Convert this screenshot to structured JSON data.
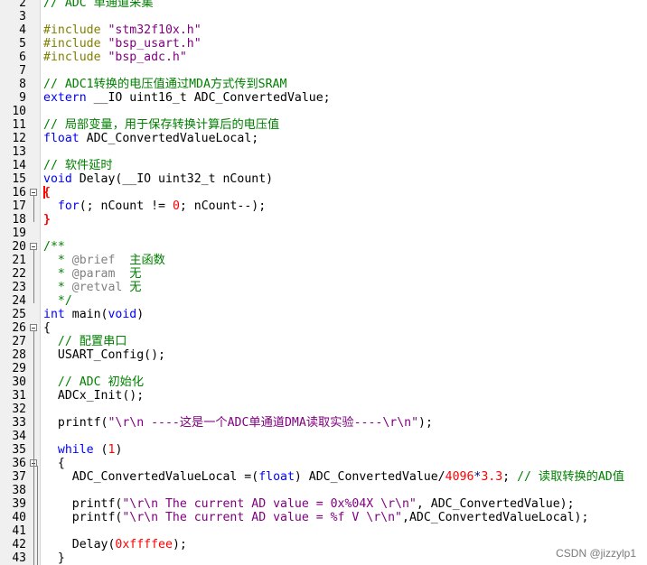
{
  "editor": {
    "lines": [
      {
        "n": "2",
        "fold": false,
        "segments": [
          {
            "c": "cm",
            "t": "// ADC 单通道采集"
          }
        ]
      },
      {
        "n": "3",
        "fold": false,
        "segments": []
      },
      {
        "n": "4",
        "fold": false,
        "segments": [
          {
            "c": "pp",
            "t": "#include "
          },
          {
            "c": "str",
            "t": "\"stm32f10x.h\""
          }
        ]
      },
      {
        "n": "5",
        "fold": false,
        "segments": [
          {
            "c": "pp",
            "t": "#include "
          },
          {
            "c": "str",
            "t": "\"bsp_usart.h\""
          }
        ]
      },
      {
        "n": "6",
        "fold": false,
        "segments": [
          {
            "c": "pp",
            "t": "#include "
          },
          {
            "c": "str",
            "t": "\"bsp_adc.h\""
          }
        ]
      },
      {
        "n": "7",
        "fold": false,
        "segments": []
      },
      {
        "n": "8",
        "fold": false,
        "segments": [
          {
            "c": "cm",
            "t": "// ADC1转换的电压值通过MDA方式传到SRAM"
          }
        ]
      },
      {
        "n": "9",
        "fold": false,
        "segments": [
          {
            "c": "kw",
            "t": "extern"
          },
          {
            "c": "ty",
            "t": " __IO uint16_t ADC_ConvertedValue;"
          }
        ]
      },
      {
        "n": "10",
        "fold": false,
        "segments": []
      },
      {
        "n": "11",
        "fold": false,
        "segments": [
          {
            "c": "cm",
            "t": "// 局部变量，用于保存转换计算后的电压值"
          }
        ]
      },
      {
        "n": "12",
        "fold": false,
        "segments": [
          {
            "c": "kw",
            "t": "float"
          },
          {
            "c": "ty",
            "t": " ADC_ConvertedValueLocal;"
          }
        ]
      },
      {
        "n": "13",
        "fold": false,
        "segments": []
      },
      {
        "n": "14",
        "fold": false,
        "segments": [
          {
            "c": "cm",
            "t": "// 软件延时"
          }
        ]
      },
      {
        "n": "15",
        "fold": false,
        "segments": [
          {
            "c": "kw",
            "t": "void"
          },
          {
            "c": "ty",
            "t": " Delay(__IO uint32_t nCount)"
          }
        ]
      },
      {
        "n": "16",
        "fold": true,
        "segments": [
          {
            "c": "brk",
            "t": "{"
          }
        ]
      },
      {
        "n": "17",
        "fold": false,
        "segments": [
          {
            "c": "ty",
            "t": "  "
          },
          {
            "c": "kw",
            "t": "for"
          },
          {
            "c": "ty",
            "t": "(; nCount != "
          },
          {
            "c": "num",
            "t": "0"
          },
          {
            "c": "ty",
            "t": "; nCount--);"
          }
        ]
      },
      {
        "n": "18",
        "fold": false,
        "segments": [
          {
            "c": "brk",
            "t": "}"
          }
        ]
      },
      {
        "n": "19",
        "fold": false,
        "segments": []
      },
      {
        "n": "20",
        "fold": true,
        "segments": [
          {
            "c": "cm",
            "t": "/**"
          }
        ]
      },
      {
        "n": "21",
        "fold": false,
        "segments": [
          {
            "c": "cm",
            "t": "  * "
          },
          {
            "c": "dt",
            "t": "@brief"
          },
          {
            "c": "cm",
            "t": "  主函数"
          }
        ]
      },
      {
        "n": "22",
        "fold": false,
        "segments": [
          {
            "c": "cm",
            "t": "  * "
          },
          {
            "c": "dt",
            "t": "@param"
          },
          {
            "c": "cm",
            "t": "  无"
          }
        ]
      },
      {
        "n": "23",
        "fold": false,
        "segments": [
          {
            "c": "cm",
            "t": "  * "
          },
          {
            "c": "dt",
            "t": "@retval"
          },
          {
            "c": "cm",
            "t": " 无"
          }
        ]
      },
      {
        "n": "24",
        "fold": false,
        "segments": [
          {
            "c": "cm",
            "t": "  */"
          }
        ]
      },
      {
        "n": "25",
        "fold": false,
        "segments": [
          {
            "c": "kw",
            "t": "int"
          },
          {
            "c": "ty",
            "t": " main("
          },
          {
            "c": "kw",
            "t": "void"
          },
          {
            "c": "ty",
            "t": ")"
          }
        ]
      },
      {
        "n": "26",
        "fold": true,
        "segments": [
          {
            "c": "ty",
            "t": "{"
          }
        ]
      },
      {
        "n": "27",
        "fold": false,
        "segments": [
          {
            "c": "cm",
            "t": "  // 配置串口"
          }
        ]
      },
      {
        "n": "28",
        "fold": false,
        "segments": [
          {
            "c": "ty",
            "t": "  USART_Config();"
          }
        ]
      },
      {
        "n": "29",
        "fold": false,
        "segments": []
      },
      {
        "n": "30",
        "fold": false,
        "segments": [
          {
            "c": "cm",
            "t": "  // ADC 初始化"
          }
        ]
      },
      {
        "n": "31",
        "fold": false,
        "segments": [
          {
            "c": "ty",
            "t": "  ADCx_Init();"
          }
        ]
      },
      {
        "n": "32",
        "fold": false,
        "segments": []
      },
      {
        "n": "33",
        "fold": false,
        "segments": [
          {
            "c": "ty",
            "t": "  printf("
          },
          {
            "c": "str",
            "t": "\"\\r\\n ----这是一个ADC单通道DMA读取实验----\\r\\n\""
          },
          {
            "c": "ty",
            "t": ");"
          }
        ]
      },
      {
        "n": "34",
        "fold": false,
        "segments": []
      },
      {
        "n": "35",
        "fold": false,
        "segments": [
          {
            "c": "ty",
            "t": "  "
          },
          {
            "c": "kw",
            "t": "while"
          },
          {
            "c": "ty",
            "t": " ("
          },
          {
            "c": "num",
            "t": "1"
          },
          {
            "c": "ty",
            "t": ")"
          }
        ]
      },
      {
        "n": "36",
        "fold": true,
        "segments": [
          {
            "c": "ty",
            "t": "  {"
          }
        ]
      },
      {
        "n": "37",
        "fold": false,
        "segments": [
          {
            "c": "ty",
            "t": "    ADC_ConvertedValueLocal =("
          },
          {
            "c": "kw",
            "t": "float"
          },
          {
            "c": "ty",
            "t": ") ADC_ConvertedValue/"
          },
          {
            "c": "num",
            "t": "4096"
          },
          {
            "c": "op",
            "t": "*"
          },
          {
            "c": "num",
            "t": "3.3"
          },
          {
            "c": "ty",
            "t": "; "
          },
          {
            "c": "cm",
            "t": "// 读取转换的AD值"
          }
        ]
      },
      {
        "n": "38",
        "fold": false,
        "segments": []
      },
      {
        "n": "39",
        "fold": false,
        "segments": [
          {
            "c": "ty",
            "t": "    printf("
          },
          {
            "c": "str",
            "t": "\"\\r\\n The current AD value = 0x%04X \\r\\n\""
          },
          {
            "c": "ty",
            "t": ", ADC_ConvertedValue);"
          }
        ]
      },
      {
        "n": "40",
        "fold": false,
        "segments": [
          {
            "c": "ty",
            "t": "    printf("
          },
          {
            "c": "str",
            "t": "\"\\r\\n The current AD value = %f V \\r\\n\""
          },
          {
            "c": "ty",
            "t": ",ADC_ConvertedValueLocal);"
          }
        ]
      },
      {
        "n": "41",
        "fold": false,
        "segments": []
      },
      {
        "n": "42",
        "fold": false,
        "segments": [
          {
            "c": "ty",
            "t": "    Delay("
          },
          {
            "c": "num",
            "t": "0xffffee"
          },
          {
            "c": "ty",
            "t": ");"
          }
        ]
      },
      {
        "n": "43",
        "fold": false,
        "segments": [
          {
            "c": "ty",
            "t": "  }"
          }
        ]
      }
    ]
  },
  "watermark": {
    "text": "CSDN @jizzylp1"
  },
  "colors": {
    "keyword": "#0000ff",
    "preprocessor": "#808000",
    "string": "#800080",
    "comment": "#008000",
    "number": "#ff0000",
    "doc_tag": "#808080"
  }
}
